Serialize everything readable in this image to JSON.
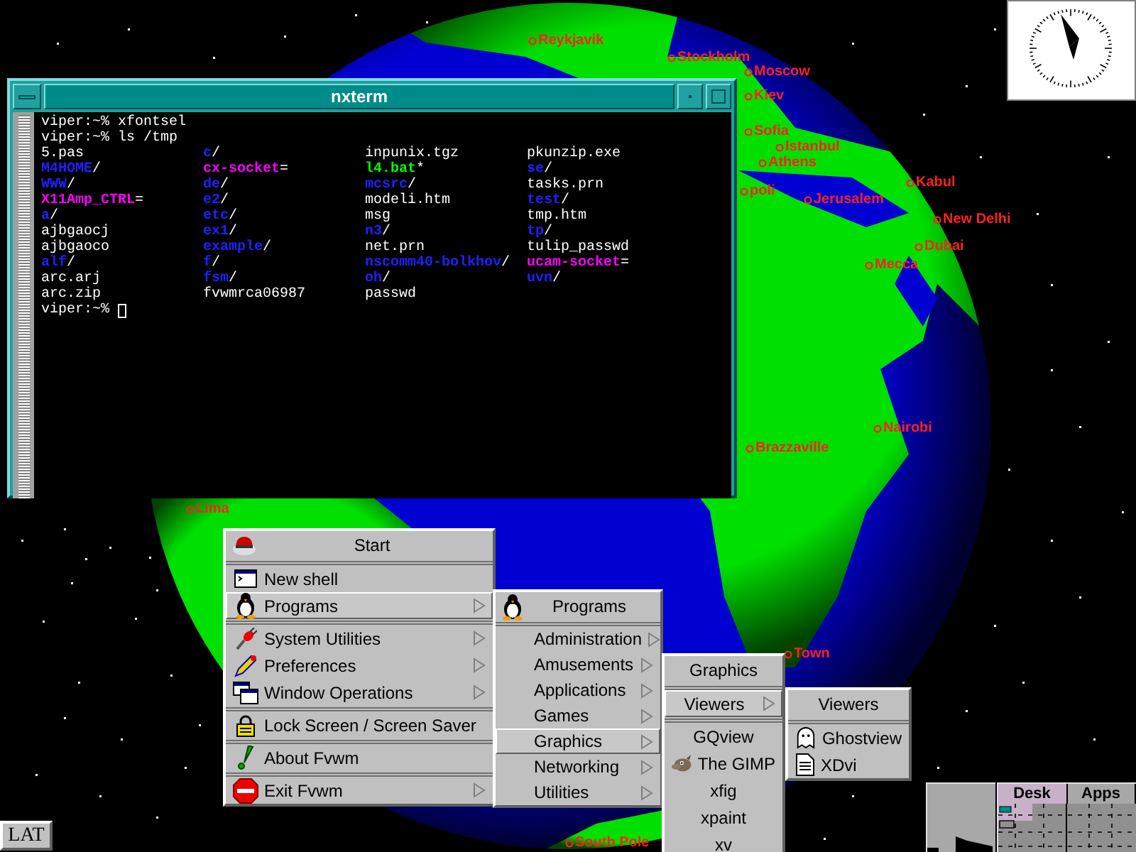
{
  "cities": [
    {
      "name": "Reykjavik"
    },
    {
      "name": "Stockholm"
    },
    {
      "name": "Moscow"
    },
    {
      "name": "Kiev"
    },
    {
      "name": "Sofia"
    },
    {
      "name": "Istanbul"
    },
    {
      "name": "Athens"
    },
    {
      "name": "poli"
    },
    {
      "name": "Jerusalem"
    },
    {
      "name": "Kabul"
    },
    {
      "name": "New Delhi"
    },
    {
      "name": "Dubai"
    },
    {
      "name": "Mecca"
    },
    {
      "name": "Nairobi"
    },
    {
      "name": "Brazzaville"
    },
    {
      "name": "Lima"
    },
    {
      "name": "Town"
    },
    {
      "name": "South Pole"
    }
  ],
  "terminal": {
    "title": "nxterm",
    "commands": [
      "viper:~% xfontsel",
      "viper:~% ls /tmp"
    ],
    "prompt": "viper:~%",
    "listing": [
      [
        {
          "text": "5.pas",
          "kind": "file"
        },
        {
          "text": "c",
          "suffix": "/",
          "kind": "dir"
        },
        {
          "text": "inpunix.tgz",
          "kind": "file"
        },
        {
          "text": "pkunzip.exe",
          "kind": "file"
        }
      ],
      [
        {
          "text": "M4HOME",
          "suffix": "/",
          "kind": "dir"
        },
        {
          "text": "cx-socket",
          "suffix": "=",
          "kind": "socket"
        },
        {
          "text": "l4.bat",
          "suffix": "*",
          "kind": "exec"
        },
        {
          "text": "se",
          "suffix": "/",
          "kind": "dir"
        }
      ],
      [
        {
          "text": "WWW",
          "suffix": "/",
          "kind": "dir"
        },
        {
          "text": "de",
          "suffix": "/",
          "kind": "dir"
        },
        {
          "text": "mcsrc",
          "suffix": "/",
          "kind": "dir"
        },
        {
          "text": "tasks.prn",
          "kind": "file"
        }
      ],
      [
        {
          "text": "X11Amp_CTRL",
          "suffix": "=",
          "kind": "socket"
        },
        {
          "text": "e2",
          "suffix": "/",
          "kind": "dir"
        },
        {
          "text": "modeli.htm",
          "kind": "file"
        },
        {
          "text": "test",
          "suffix": "/",
          "kind": "dir"
        }
      ],
      [
        {
          "text": "a",
          "suffix": "/",
          "kind": "dir"
        },
        {
          "text": "etc",
          "suffix": "/",
          "kind": "dir"
        },
        {
          "text": "msg",
          "kind": "file"
        },
        {
          "text": "tmp.htm",
          "kind": "file"
        }
      ],
      [
        {
          "text": "ajbgaocj",
          "kind": "file"
        },
        {
          "text": "ex1",
          "suffix": "/",
          "kind": "dir"
        },
        {
          "text": "n3",
          "suffix": "/",
          "kind": "dir"
        },
        {
          "text": "tp",
          "suffix": "/",
          "kind": "dir"
        }
      ],
      [
        {
          "text": "ajbgaoco",
          "kind": "file"
        },
        {
          "text": "example",
          "suffix": "/",
          "kind": "dir"
        },
        {
          "text": "net.prn",
          "kind": "file"
        },
        {
          "text": "tulip_passwd",
          "kind": "file"
        }
      ],
      [
        {
          "text": "alf",
          "suffix": "/",
          "kind": "dir"
        },
        {
          "text": "f",
          "suffix": "/",
          "kind": "dir"
        },
        {
          "text": "nscomm40-bolkhov",
          "suffix": "/",
          "kind": "dir"
        },
        {
          "text": "ucam-socket",
          "suffix": "=",
          "kind": "socket"
        }
      ],
      [
        {
          "text": "arc.arj",
          "kind": "file"
        },
        {
          "text": "fsm",
          "suffix": "/",
          "kind": "dir"
        },
        {
          "text": "oh",
          "suffix": "/",
          "kind": "dir"
        },
        {
          "text": "uvn",
          "suffix": "/",
          "kind": "dir"
        }
      ],
      [
        {
          "text": "arc.zip",
          "kind": "file"
        },
        {
          "text": "fvwmrca06987",
          "kind": "file"
        },
        {
          "text": "passwd",
          "kind": "file"
        }
      ]
    ]
  },
  "menus": [
    {
      "title": "Start",
      "groups": [
        [
          {
            "label": "New shell",
            "submenu": false,
            "selected": false
          },
          {
            "label": "Programs",
            "submenu": true,
            "selected": true
          }
        ],
        [
          {
            "label": "System Utilities",
            "submenu": true,
            "selected": false
          },
          {
            "label": "Preferences",
            "submenu": true,
            "selected": false
          },
          {
            "label": "Window Operations",
            "submenu": true,
            "selected": false
          }
        ],
        [
          {
            "label": "Lock Screen / Screen Saver",
            "submenu": false,
            "selected": false
          }
        ],
        [
          {
            "label": "About Fvwm",
            "submenu": false,
            "selected": false
          }
        ],
        [
          {
            "label": "Exit Fvwm",
            "submenu": true,
            "selected": false
          }
        ]
      ]
    },
    {
      "title": "Programs",
      "groups": [
        [
          {
            "label": "Administration",
            "submenu": true,
            "selected": false
          },
          {
            "label": "Amusements",
            "submenu": true,
            "selected": false
          },
          {
            "label": "Applications",
            "submenu": true,
            "selected": false
          },
          {
            "label": "Games",
            "submenu": true,
            "selected": false
          },
          {
            "label": "Graphics",
            "submenu": true,
            "selected": true
          },
          {
            "label": "Networking",
            "submenu": true,
            "selected": false
          },
          {
            "label": "Utilities",
            "submenu": true,
            "selected": false
          }
        ]
      ]
    },
    {
      "title": "Graphics",
      "groups": [
        [
          {
            "label": "Viewers",
            "submenu": true,
            "selected": true
          }
        ],
        [
          {
            "label": "GQview",
            "submenu": false,
            "selected": false
          },
          {
            "label": "The GIMP",
            "submenu": false,
            "selected": false
          },
          {
            "label": "xfig",
            "submenu": false,
            "selected": false
          },
          {
            "label": "xpaint",
            "submenu": false,
            "selected": false
          },
          {
            "label": "xv",
            "submenu": false,
            "selected": false
          }
        ]
      ]
    },
    {
      "title": "Viewers",
      "groups": [
        [
          {
            "label": "Ghostview",
            "submenu": false,
            "selected": false
          },
          {
            "label": "XDvi",
            "submenu": false,
            "selected": false
          }
        ]
      ]
    }
  ],
  "pager": {
    "tabs": [
      {
        "label": "Desk",
        "selected": true
      },
      {
        "label": "Apps",
        "selected": false
      }
    ]
  },
  "keyboard_indicator": "LAT"
}
